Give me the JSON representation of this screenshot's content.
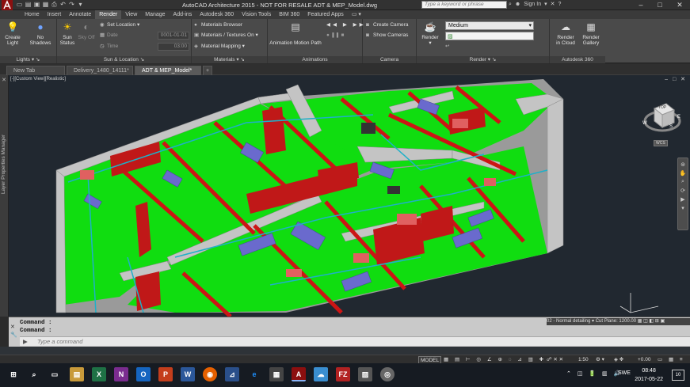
{
  "window": {
    "title": "AutoCAD Architecture 2015 - NOT FOR RESALE    ADT & MEP_Model.dwg",
    "search_placeholder": "Type a keyword or phrase",
    "sign_in": "Sign In"
  },
  "ribbon_tabs": [
    "Home",
    "Insert",
    "Annotate",
    "Render",
    "View",
    "Manage",
    "Add-ins",
    "Autodesk 360",
    "Vision Tools",
    "BIM 360",
    "Featured Apps"
  ],
  "ribbon_active": "Render",
  "panels": {
    "lights": {
      "title": "Lights",
      "create_light": "Create Light",
      "no_shadows": "No Shadows"
    },
    "sun": {
      "title": "Sun & Location",
      "sun_status": "Sun Status",
      "sky_off": "Sky Off",
      "set_location": "Set Location",
      "date_label": "Date",
      "date_value": "0001-01-01",
      "time_label": "Time",
      "time_value": "03:00"
    },
    "materials": {
      "title": "Materials",
      "browser": "Materials Browser",
      "textures": "Materials / Textures On",
      "mapping": "Material Mapping"
    },
    "animations": {
      "title": "Animations",
      "motion_path": "Animation Motion Path"
    },
    "camera": {
      "title": "Camera",
      "create_camera": "Create Camera",
      "show_cameras": "Show Cameras"
    },
    "render": {
      "title": "Render",
      "render_btn": "Render",
      "quality": "Medium"
    },
    "a360": {
      "title": "Autodesk 360",
      "render_cloud": "Render in Cloud",
      "render_gallery": "Render Gallery"
    }
  },
  "doc_tabs": [
    {
      "label": "New Tab"
    },
    {
      "label": "Delivery_1480_14111*"
    },
    {
      "label": "ADT & MEP_Model*"
    }
  ],
  "doc_active": "ADT & MEP_Model*",
  "viewport": {
    "label": "[-][Custom View][Realistic]",
    "viewcube_top": "TOP",
    "wcs": "WCS",
    "compass_w": "W",
    "compass_s": "S",
    "compass_e": "E"
  },
  "side_palette": "Layer Properties Manager",
  "command": {
    "line1": "Command :",
    "line2": "Command :",
    "placeholder": "Type a command"
  },
  "status": {
    "model": "MODEL",
    "display_config": "02 - Normal detailing",
    "cut_plane": "Cut Plane: 1200.00",
    "scale": "1:50",
    "elevation": "+0.00"
  },
  "taskbar": {
    "time": "08:48",
    "date": "2017-05-22",
    "lang": "SWE",
    "notif": "10"
  },
  "colors": {
    "floor": "#10dd10",
    "wall": "#c0c0c0",
    "red": "#cc1515",
    "duct": "#6a6acd",
    "pipe": "#1fb0c8"
  }
}
